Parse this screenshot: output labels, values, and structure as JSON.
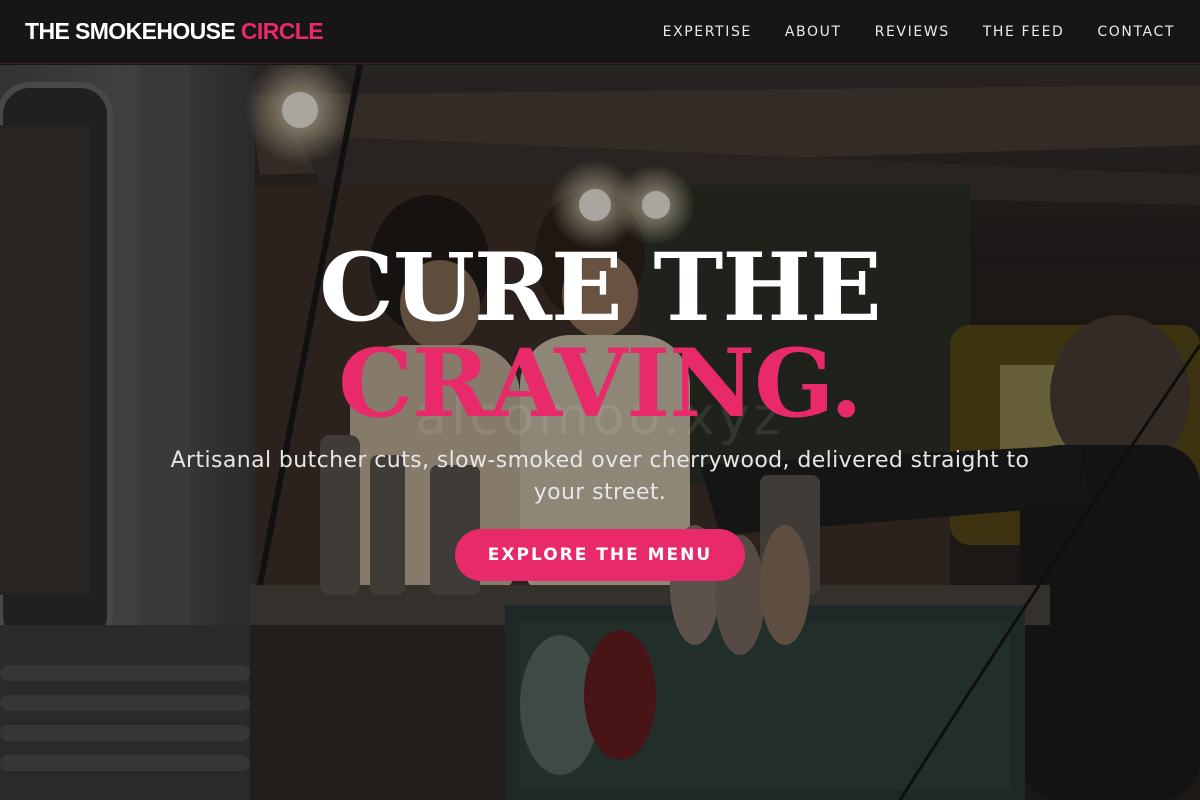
{
  "brand": {
    "name": "THE SMOKEHOUSE",
    "accent": "CIRCLE"
  },
  "nav": {
    "links": [
      {
        "label": "EXPERTISE"
      },
      {
        "label": "ABOUT"
      },
      {
        "label": "REVIEWS"
      },
      {
        "label": "THE FEED"
      },
      {
        "label": "CONTACT"
      }
    ]
  },
  "hero": {
    "headline_line1": "CURE THE",
    "headline_line2": "CRAVING.",
    "watermark": "alcomoo.xyz",
    "subtitle": "Artisanal butcher cuts, slow-smoked over cherrywood, delivered straight to your street.",
    "cta_label": "EXPLORE THE MENU"
  },
  "colors": {
    "accent": "#e8296a",
    "nav_background": "#161616",
    "text": "#ffffff"
  }
}
